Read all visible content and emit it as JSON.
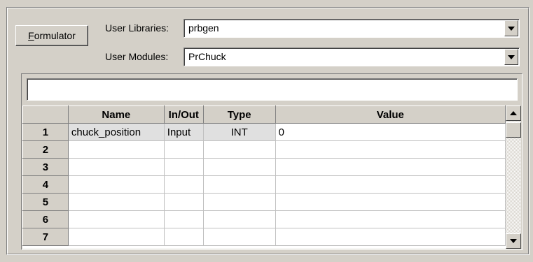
{
  "formulator_button": {
    "mnemonic": "F",
    "rest": "ormulator"
  },
  "libraries": {
    "label": "User Libraries:",
    "value": "prbgen"
  },
  "modules": {
    "label": "User Modules:",
    "value": "PrChuck"
  },
  "edit_bar": {
    "value": ""
  },
  "table": {
    "columns": [
      "",
      "Name",
      "In/Out",
      "Type",
      "Value"
    ],
    "rows": [
      {
        "num": "1",
        "name": "chuck_position",
        "inout": "Input",
        "type": "INT",
        "value": "0"
      },
      {
        "num": "2",
        "name": "",
        "inout": "",
        "type": "",
        "value": ""
      },
      {
        "num": "3",
        "name": "",
        "inout": "",
        "type": "",
        "value": ""
      },
      {
        "num": "4",
        "name": "",
        "inout": "",
        "type": "",
        "value": ""
      },
      {
        "num": "5",
        "name": "",
        "inout": "",
        "type": "",
        "value": ""
      },
      {
        "num": "6",
        "name": "",
        "inout": "",
        "type": "",
        "value": ""
      },
      {
        "num": "7",
        "name": "",
        "inout": "",
        "type": "",
        "value": ""
      }
    ]
  },
  "icons": {
    "combo_arrow": "chevron-down-icon",
    "scroll_up": "scroll-up-arrow-icon",
    "scroll_down": "scroll-down-arrow-icon"
  }
}
